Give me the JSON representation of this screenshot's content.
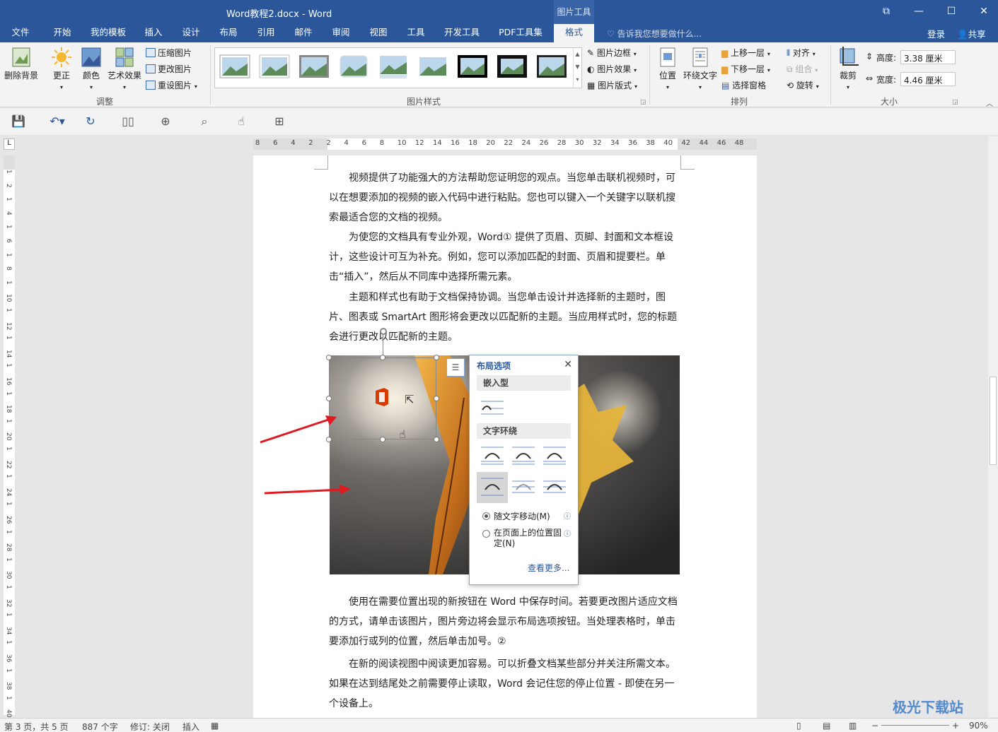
{
  "window": {
    "title": "Word教程2.docx - Word",
    "context_tab_group": "图片工具",
    "controls": {
      "restore_ribbon": "⧉",
      "minimize": "—",
      "maximize": "☐",
      "close": "✕"
    }
  },
  "tabs": [
    "文件",
    "开始",
    "我的模板",
    "插入",
    "设计",
    "布局",
    "引用",
    "邮件",
    "审阅",
    "视图",
    "工具",
    "开发工具",
    "PDF工具集",
    "格式"
  ],
  "active_tab": "格式",
  "tell_me": "告诉我您想要做什么...",
  "account": {
    "login": "登录",
    "share": "共享"
  },
  "ribbon": {
    "adjust": {
      "remove_bg": "删除背景",
      "corrections": "更正",
      "color": "颜色",
      "artistic": "艺术效果",
      "compress": "压缩图片",
      "change": "更改图片",
      "reset": "重设图片",
      "label": "调整"
    },
    "styles": {
      "border": "图片边框",
      "effects": "图片效果",
      "layout": "图片版式",
      "label": "图片样式"
    },
    "arrange": {
      "position": "位置",
      "wrap": "环绕文字",
      "forward": "上移一层",
      "backward": "下移一层",
      "selection_pane": "选择窗格",
      "align": "对齐",
      "group": "组合",
      "rotate": "旋转",
      "label": "排列"
    },
    "size": {
      "crop": "裁剪",
      "height_label": "高度:",
      "height_value": "3.38 厘米",
      "width_label": "宽度:",
      "width_value": "4.46 厘米",
      "label": "大小"
    }
  },
  "ruler": {
    "h_numbers": [
      "8",
      "6",
      "4",
      "2",
      "2",
      "4",
      "6",
      "8",
      "10",
      "12",
      "14",
      "16",
      "18",
      "20",
      "22",
      "24",
      "26",
      "28",
      "30",
      "32",
      "34",
      "36",
      "38",
      "40",
      "42",
      "44",
      "46",
      "48"
    ],
    "v_numbers": [
      "1",
      "2",
      "1",
      "4",
      "1",
      "6",
      "1",
      "8",
      "1",
      "10",
      "1",
      "12",
      "1",
      "14",
      "1",
      "16",
      "1",
      "18",
      "1",
      "20",
      "1",
      "22",
      "1",
      "24",
      "1",
      "26",
      "1",
      "28",
      "1",
      "30",
      "1",
      "32",
      "1",
      "34",
      "1",
      "36",
      "1",
      "38",
      "1",
      "40"
    ]
  },
  "document": {
    "p1": "视频提供了功能强大的方法帮助您证明您的观点。当您单击联机视频时，可以在想要添加的视频的嵌入代码中进行粘贴。您也可以键入一个关键字以联机搜索最适合您的文档的视频。",
    "p2": "为使您的文档具有专业外观，Word① 提供了页眉、页脚、封面和文本框设计，这些设计可互为补充。例如，您可以添加匹配的封面、页眉和提要栏。单击“插入”，然后从不同库中选择所需元素。",
    "p3": "主题和样式也有助于文档保持协调。当您单击设计并选择新的主题时，图片、图表或 SmartArt 图形将会更改以匹配新的主题。当应用样式时，您的标题会进行更改以匹配新的主题。",
    "p4": "使用在需要位置出现的新按钮在 Word 中保存时间。若要更改图片适应文档的方式，请单击该图片，图片旁边将会显示布局选项按钮。当处理表格时，单击要添加行或列的位置，然后单击加号。②",
    "p5": "在新的阅读视图中阅读更加容易。可以折叠文档某些部分并关注所需文本。如果在达到结尾处之前需要停止读取，Word 会记住您的停止位置 - 即使在另一个设备上。"
  },
  "layout_options": {
    "title": "布局选项",
    "close": "✕",
    "inline_section": "嵌入型",
    "wrap_section": "文字环绕",
    "move_with_text": "随文字移动(M)",
    "fix_position": "在页面上的位置固定(N)",
    "more": "查看更多..."
  },
  "status": {
    "page": "第 3 页，共 5 页",
    "words": "887 个字",
    "track": "修订: 关闭",
    "mode": "插入",
    "zoom": "90%"
  },
  "colors": {
    "brand": "#2b579a",
    "arrow": "#e0191f"
  },
  "watermark": "极光下载站"
}
